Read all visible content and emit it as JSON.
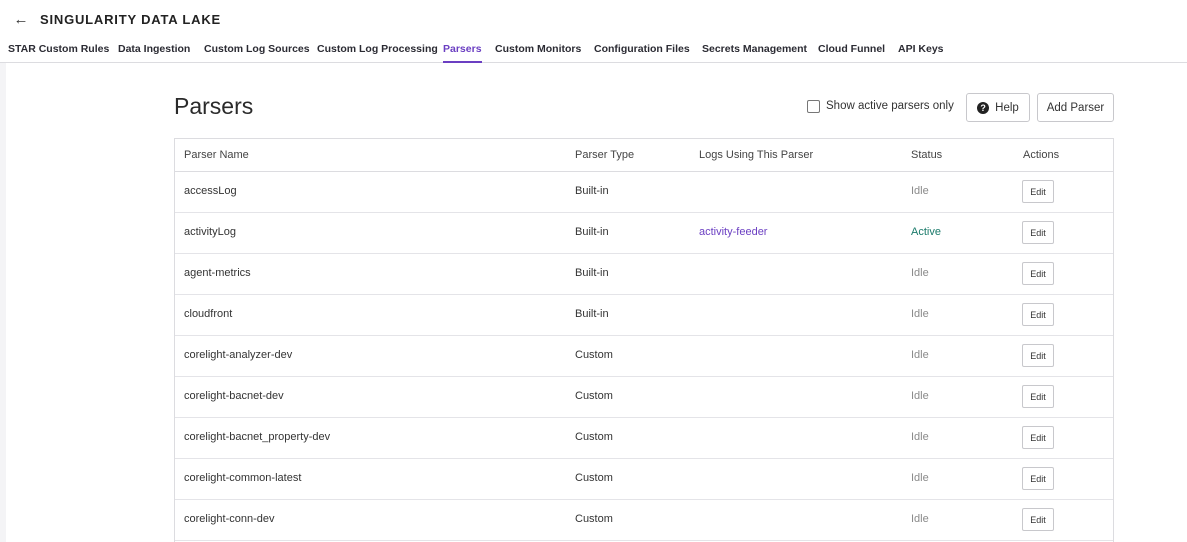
{
  "header": {
    "back_icon": "←",
    "title": "SINGULARITY DATA LAKE"
  },
  "tabs": [
    {
      "label": "STAR Custom Rules",
      "active": false
    },
    {
      "label": "Data Ingestion",
      "active": false
    },
    {
      "label": "Custom Log Sources",
      "active": false
    },
    {
      "label": "Custom Log Processing",
      "active": false
    },
    {
      "label": "Parsers",
      "active": true
    },
    {
      "label": "Custom Monitors",
      "active": false
    },
    {
      "label": "Configuration Files",
      "active": false
    },
    {
      "label": "Secrets Management",
      "active": false
    },
    {
      "label": "Cloud Funnel",
      "active": false
    },
    {
      "label": "API Keys",
      "active": false
    }
  ],
  "page": {
    "title": "Parsers",
    "show_active_label": "Show active parsers only",
    "show_active_checked": false,
    "help_label": "Help",
    "add_parser_label": "Add Parser"
  },
  "table": {
    "columns": [
      "Parser Name",
      "Parser Type",
      "Logs Using This Parser",
      "Status",
      "Actions"
    ],
    "rows": [
      {
        "name": "accessLog",
        "type": "Built-in",
        "logs": "",
        "status": "Idle",
        "action": "Edit"
      },
      {
        "name": "activityLog",
        "type": "Built-in",
        "logs": "activity-feeder",
        "status": "Active",
        "action": "Edit"
      },
      {
        "name": "agent-metrics",
        "type": "Built-in",
        "logs": "",
        "status": "Idle",
        "action": "Edit"
      },
      {
        "name": "cloudfront",
        "type": "Built-in",
        "logs": "",
        "status": "Idle",
        "action": "Edit"
      },
      {
        "name": "corelight-analyzer-dev",
        "type": "Custom",
        "logs": "",
        "status": "Idle",
        "action": "Edit"
      },
      {
        "name": "corelight-bacnet-dev",
        "type": "Custom",
        "logs": "",
        "status": "Idle",
        "action": "Edit"
      },
      {
        "name": "corelight-bacnet_property-dev",
        "type": "Custom",
        "logs": "",
        "status": "Idle",
        "action": "Edit"
      },
      {
        "name": "corelight-common-latest",
        "type": "Custom",
        "logs": "",
        "status": "Idle",
        "action": "Edit"
      },
      {
        "name": "corelight-conn-dev",
        "type": "Custom",
        "logs": "",
        "status": "Idle",
        "action": "Edit"
      }
    ]
  },
  "colors": {
    "accent": "#6b3fc2",
    "active_status": "#1a7a6a",
    "idle_status": "#8a8a8a"
  }
}
